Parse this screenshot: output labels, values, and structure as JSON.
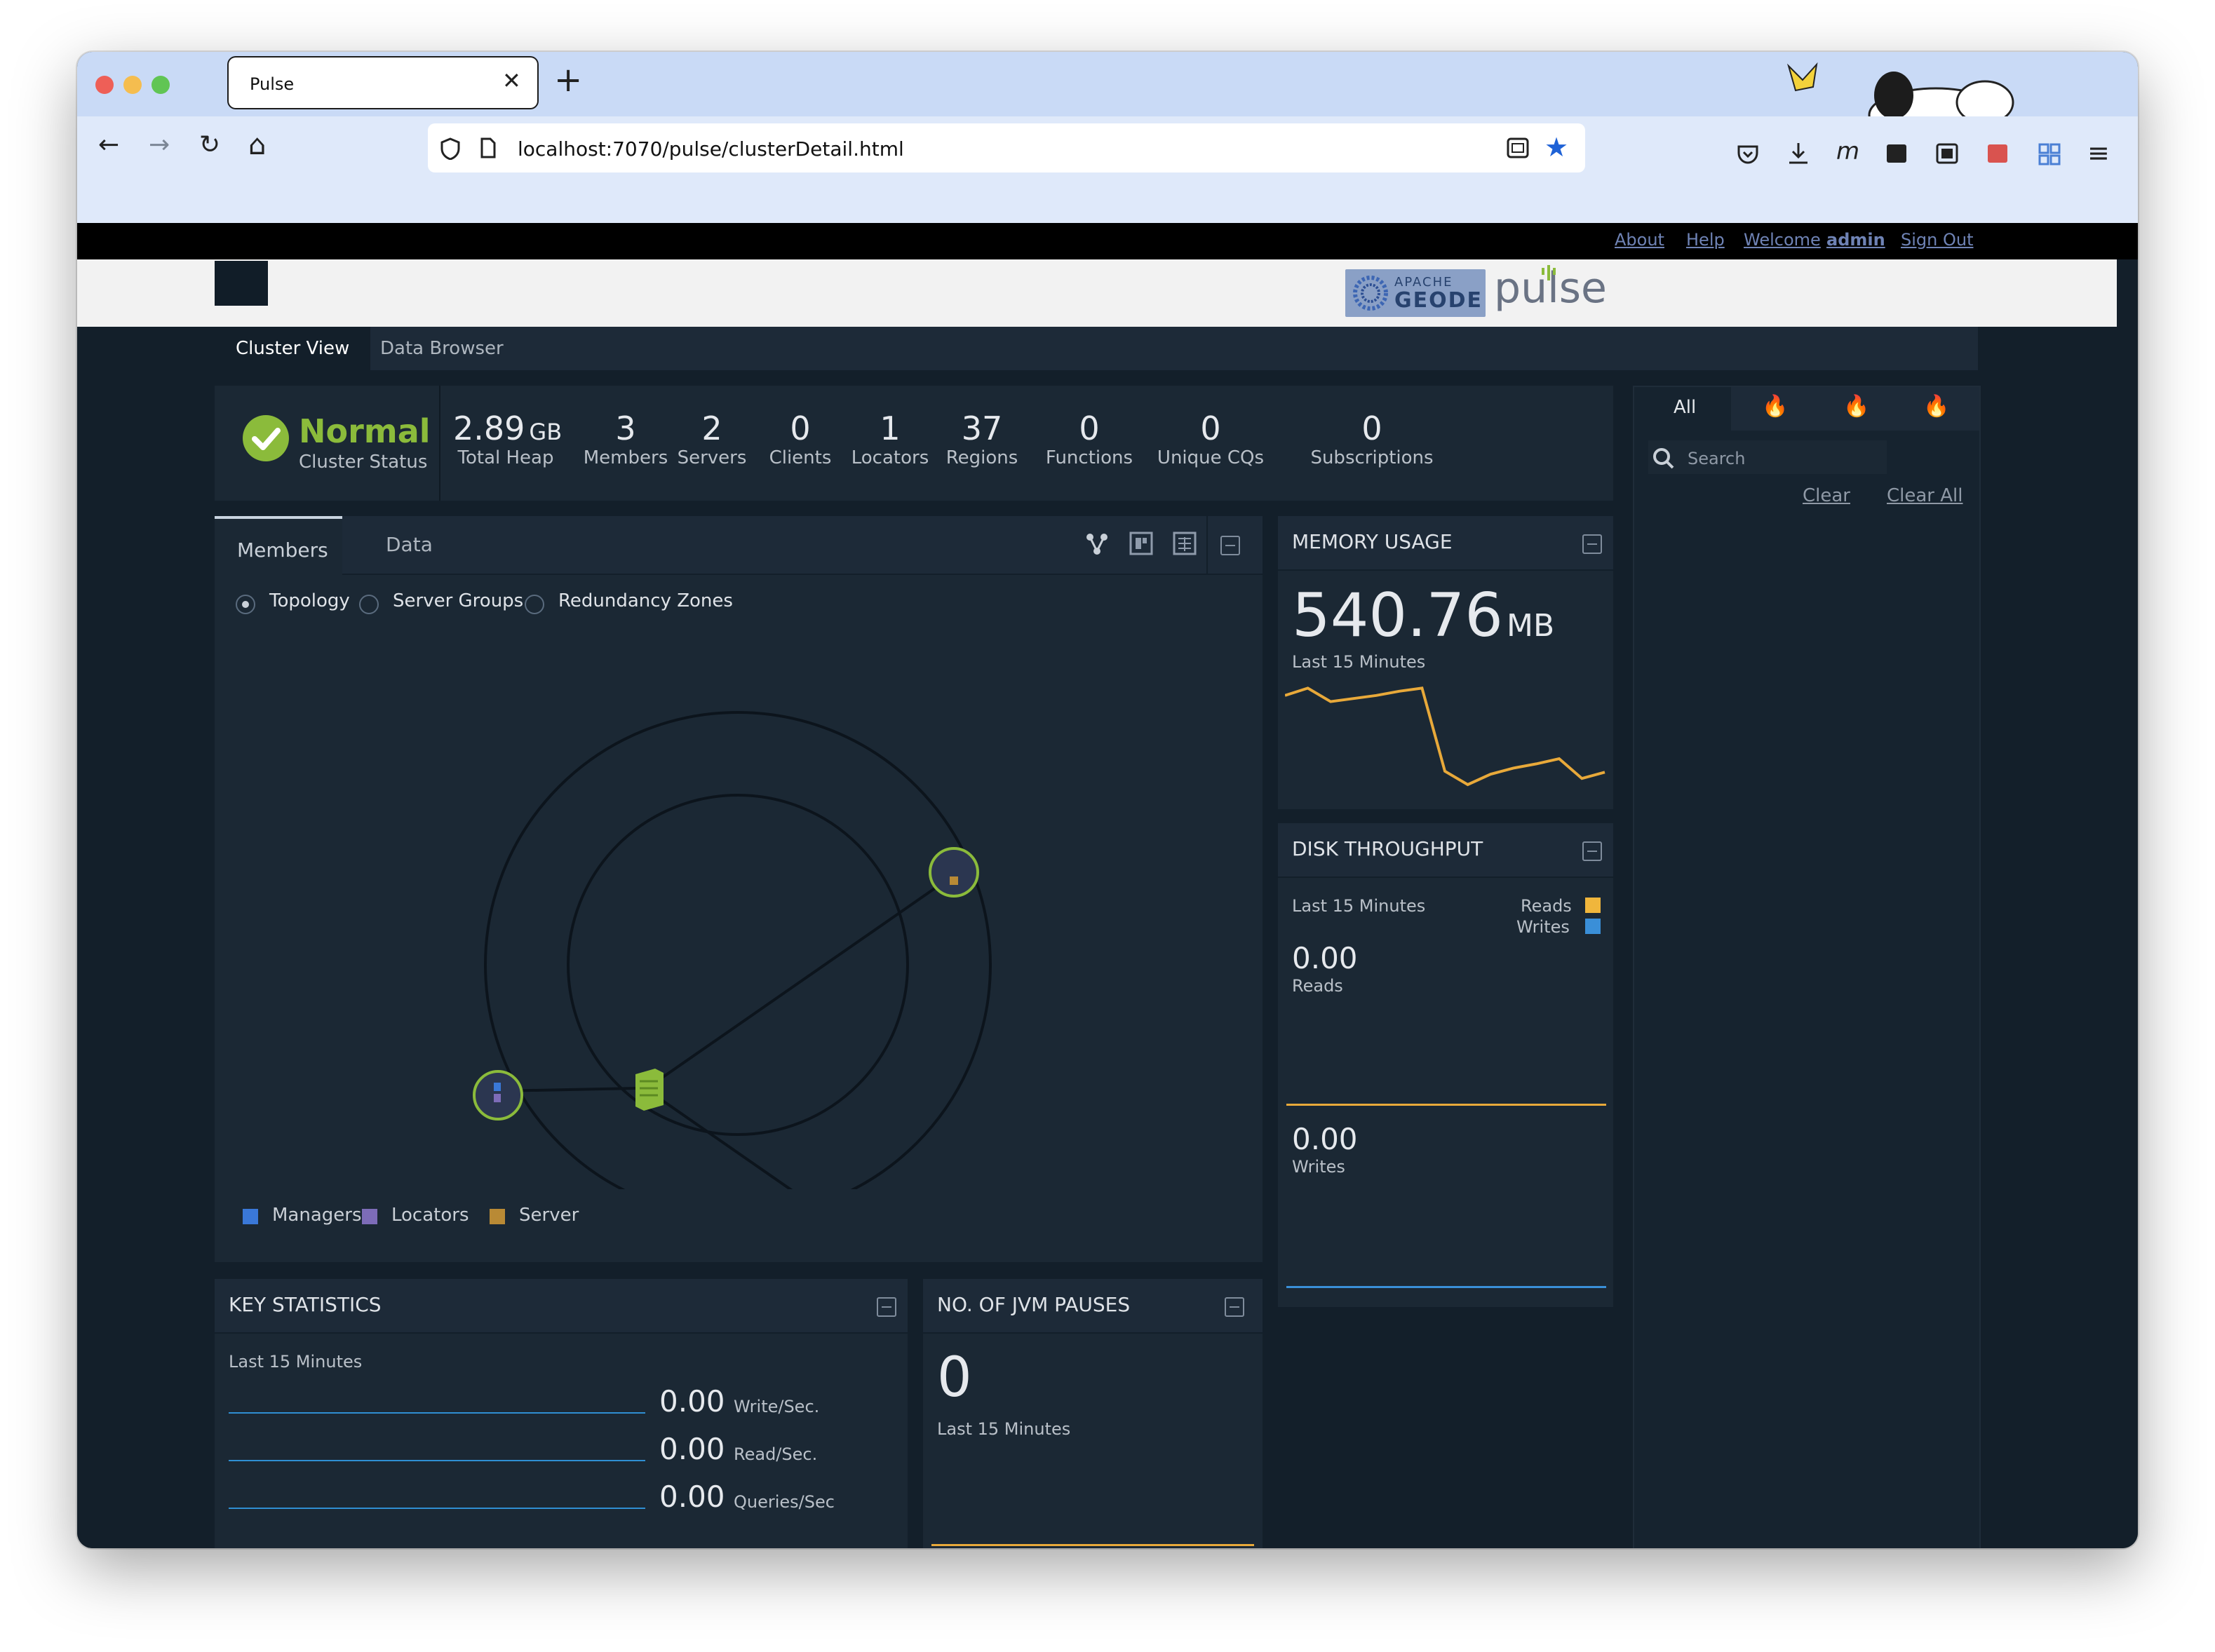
{
  "browser": {
    "tab_title": "Pulse",
    "tab_close": "✕",
    "new_tab": "+",
    "url": "localhost:7070/pulse/clusterDetail.html",
    "back": "←",
    "forward": "→",
    "reload": "↻",
    "home": "⌂",
    "menu": "≡"
  },
  "top_links": {
    "about": "About",
    "help": "Help",
    "welcome": "Welcome",
    "user": "admin",
    "sign_out": "Sign Out"
  },
  "branding": {
    "apache": "APACHE",
    "geode": "GEODE",
    "pulse": "pulse"
  },
  "nav_tabs": [
    {
      "label": "Cluster View",
      "active": true
    },
    {
      "label": "Data Browser",
      "active": false
    }
  ],
  "cluster_status": {
    "status": "Normal",
    "label": "Cluster Status",
    "color": "#8bbb3b"
  },
  "summary": [
    {
      "value": "2.89",
      "unit": "GB",
      "label": "Total Heap"
    },
    {
      "value": "3",
      "unit": "",
      "label": "Members"
    },
    {
      "value": "2",
      "unit": "",
      "label": "Servers"
    },
    {
      "value": "0",
      "unit": "",
      "label": "Clients"
    },
    {
      "value": "1",
      "unit": "",
      "label": "Locators"
    },
    {
      "value": "37",
      "unit": "",
      "label": "Regions"
    },
    {
      "value": "0",
      "unit": "",
      "label": "Functions"
    },
    {
      "value": "0",
      "unit": "",
      "label": "Unique CQs"
    },
    {
      "value": "0",
      "unit": "",
      "label": "Subscriptions"
    }
  ],
  "members_panel": {
    "tabs": [
      {
        "label": "Members",
        "active": true
      },
      {
        "label": "Data",
        "active": false
      }
    ],
    "views": [
      {
        "label": "Topology",
        "selected": true
      },
      {
        "label": "Server Groups",
        "selected": false
      },
      {
        "label": "Redundancy Zones",
        "selected": false
      }
    ],
    "legend": [
      {
        "label": "Managers",
        "color": "#3a78d8"
      },
      {
        "label": "Locators",
        "color": "#7d6cb8"
      },
      {
        "label": "Server",
        "color": "#b98a35"
      }
    ]
  },
  "memory_usage": {
    "title": "MEMORY USAGE",
    "value": "540.76",
    "unit": "MB",
    "period": "Last 15 Minutes",
    "line_color": "#e8a93a",
    "trend": [
      0.88,
      0.95,
      0.82,
      0.85,
      0.88,
      0.92,
      0.95,
      0.15,
      0.02,
      0.12,
      0.18,
      0.22,
      0.27,
      0.08,
      0.14
    ]
  },
  "disk_throughput": {
    "title": "DISK THROUGHPUT",
    "period": "Last 15 Minutes",
    "legend": [
      {
        "label": "Reads",
        "color": "#f0b63c"
      },
      {
        "label": "Writes",
        "color": "#3a8fd8"
      }
    ],
    "reads_value": "0.00",
    "reads_label": "Reads",
    "writes_value": "0.00",
    "writes_label": "Writes"
  },
  "key_statistics": {
    "title": "KEY STATISTICS",
    "period": "Last 15 Minutes",
    "rows": [
      {
        "value": "0.00",
        "label": "Write/Sec."
      },
      {
        "value": "0.00",
        "label": "Read/Sec."
      },
      {
        "value": "0.00",
        "label": "Queries/Sec"
      }
    ]
  },
  "jvm_pauses": {
    "title": "NO. OF JVM PAUSES",
    "value": "0",
    "period": "Last 15 Minutes"
  },
  "alerts": {
    "tabs": [
      {
        "label": "All",
        "icon": ""
      },
      {
        "label": "",
        "icon": "severe-flame-icon"
      },
      {
        "label": "",
        "icon": "error-flame-icon"
      },
      {
        "label": "",
        "icon": "warning-flame-icon"
      }
    ],
    "search_placeholder": "Search",
    "clear": "Clear",
    "clear_all": "Clear All"
  }
}
